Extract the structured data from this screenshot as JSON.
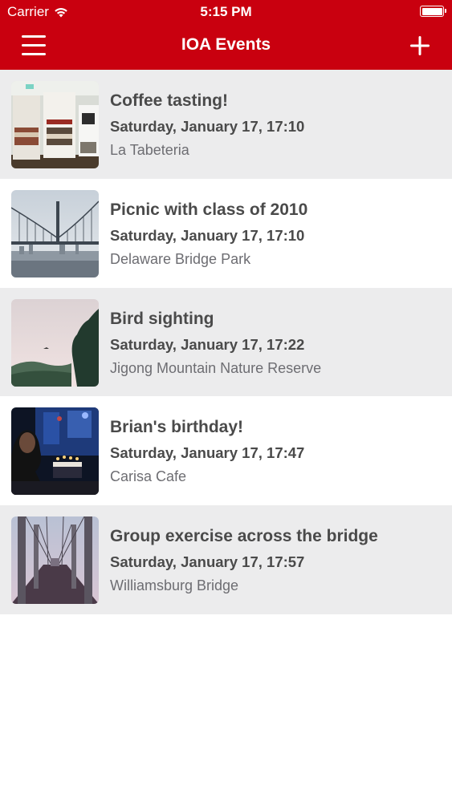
{
  "status_bar": {
    "carrier": "Carrier",
    "time": "5:15 PM"
  },
  "nav": {
    "title": "IOA Events",
    "menu_icon": "hamburger-menu-icon",
    "add_icon": "plus-icon"
  },
  "colors": {
    "accent": "#c9000f",
    "row_alt": "#ececed",
    "text_primary": "#4a4a4a",
    "text_secondary": "#6d6d72"
  },
  "events": [
    {
      "title": "Coffee tasting!",
      "date": "Saturday, January 17, 17:10",
      "location": "La Tabeteria",
      "image": "coffee-bags-photo"
    },
    {
      "title": "Picnic with class of 2010",
      "date": "Saturday, January 17, 17:10",
      "location": "Delaware Bridge Park",
      "image": "bridge-skyline-photo"
    },
    {
      "title": "Bird sighting",
      "date": "Saturday, January 17, 17:22",
      "location": "Jigong Mountain Nature Reserve",
      "image": "mountain-bird-photo"
    },
    {
      "title": "Brian's birthday!",
      "date": "Saturday, January 17, 17:47",
      "location": "Carisa Cafe",
      "image": "birthday-cake-photo"
    },
    {
      "title": "Group exercise across the bridge",
      "date": "Saturday, January 17, 17:57",
      "location": "Williamsburg Bridge",
      "image": "bridge-walkway-photo"
    }
  ]
}
